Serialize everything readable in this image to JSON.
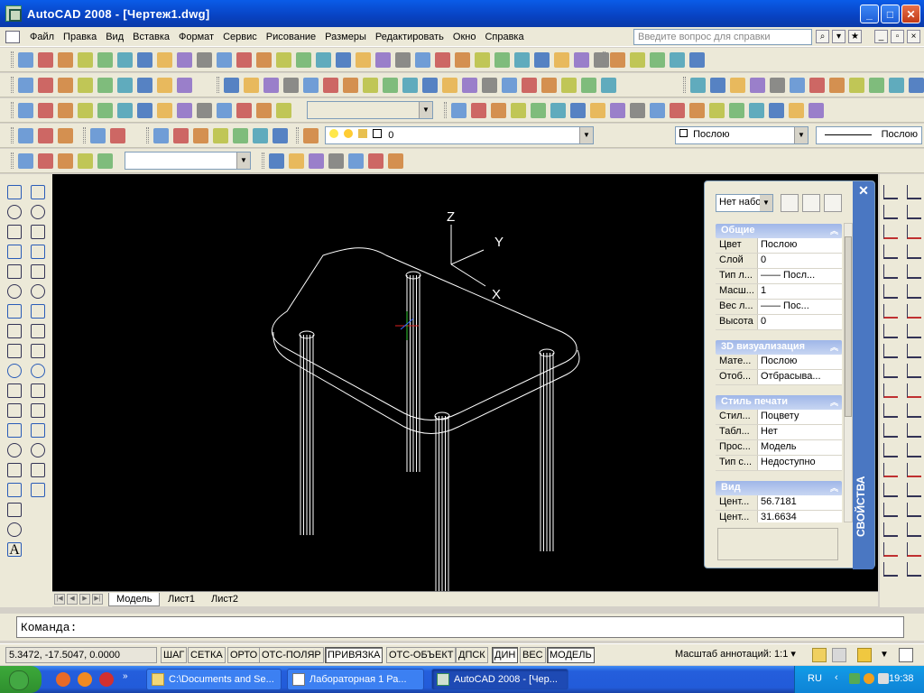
{
  "window": {
    "title": "AutoCAD 2008 - [Чертеж1.dwg]"
  },
  "menu": {
    "items": [
      "Файл",
      "Правка",
      "Вид",
      "Вставка",
      "Формат",
      "Сервис",
      "Рисование",
      "Размеры",
      "Редактировать",
      "Окно",
      "Справка"
    ],
    "help_placeholder": "Введите вопрос для справки"
  },
  "toolbars": {
    "layer_value": "0",
    "color_value": "Послою",
    "linetype_value": "Послою"
  },
  "canvas": {
    "ucs": {
      "z": "Z",
      "y": "Y",
      "x": "X"
    },
    "layout_tabs": [
      "Модель",
      "Лист1",
      "Лист2"
    ]
  },
  "properties": {
    "title": "СВОЙСТВА",
    "selection": "Нет набо",
    "sections": [
      {
        "name": "Общие",
        "rows": [
          {
            "key": "Цвет",
            "value": "Послою"
          },
          {
            "key": "Слой",
            "value": "0"
          },
          {
            "key": "Тип л...",
            "value": "—— Посл..."
          },
          {
            "key": "Масш...",
            "value": "1"
          },
          {
            "key": "Вес л...",
            "value": "—— Пос..."
          },
          {
            "key": "Высота",
            "value": "0"
          }
        ]
      },
      {
        "name": "3D визуализация",
        "rows": [
          {
            "key": "Мате...",
            "value": "Послою"
          },
          {
            "key": "Отоб...",
            "value": "Отбрасыва..."
          }
        ]
      },
      {
        "name": "Стиль печати",
        "rows": [
          {
            "key": "Стил...",
            "value": "Поцвету"
          },
          {
            "key": "Табл...",
            "value": "Нет"
          },
          {
            "key": "Прос...",
            "value": "Модель"
          },
          {
            "key": "Тип с...",
            "value": "Недоступно"
          }
        ]
      },
      {
        "name": "Вид",
        "rows": [
          {
            "key": "Цент...",
            "value": "56.7181"
          },
          {
            "key": "Цент...",
            "value": "31.6634"
          }
        ]
      }
    ]
  },
  "command": {
    "prompt": "Команда:"
  },
  "status": {
    "coords": "5.3472, -17.5047, 0.0000",
    "buttons": [
      {
        "label": "ШАГ",
        "on": false
      },
      {
        "label": "СЕТКА",
        "on": false
      },
      {
        "label": "ОРТО",
        "on": false
      },
      {
        "label": "ОТС-ПОЛЯР",
        "on": false
      },
      {
        "label": "ПРИВЯЗКА",
        "on": true
      },
      {
        "label": "ОТС-ОБЪЕКТ",
        "on": false
      },
      {
        "label": "ДПСК",
        "on": false
      },
      {
        "label": "ДИН",
        "on": true
      },
      {
        "label": "ВЕС",
        "on": false
      },
      {
        "label": "МОДЕЛЬ",
        "on": true
      }
    ],
    "annotation_scale_label": "Масштаб аннотаций:",
    "annotation_scale_value": "1:1"
  },
  "taskbar": {
    "tasks": [
      {
        "label": "C:\\Documents and Se..."
      },
      {
        "label": "Лабораторная 1 Ра..."
      },
      {
        "label": "AutoCAD 2008 - [Чер..."
      }
    ],
    "lang": "RU",
    "clock": "19:38"
  }
}
